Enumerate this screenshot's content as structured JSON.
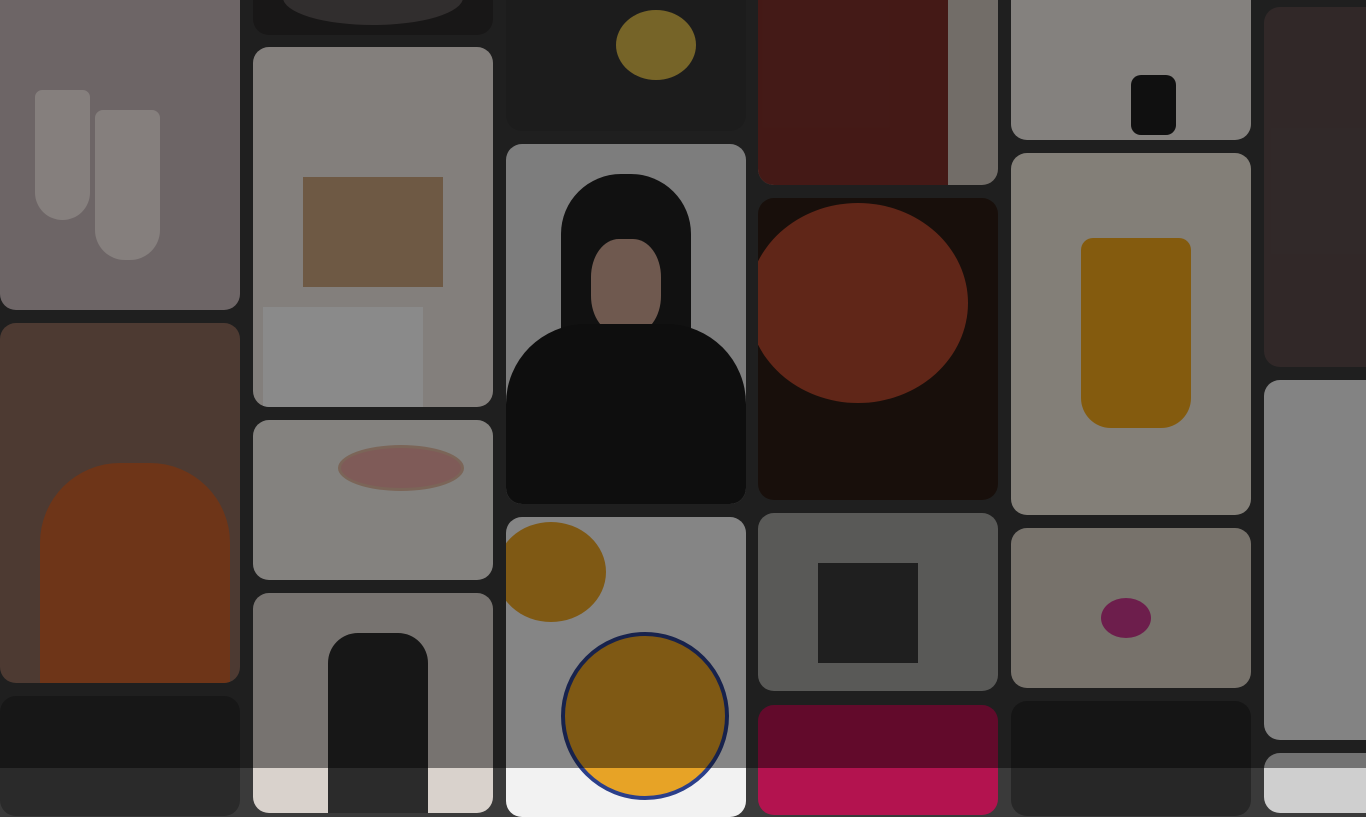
{
  "board": {
    "columns": [
      {
        "pins": [
          {
            "name": "pin-milkshakes",
            "color": "#c7b9bb",
            "accent": "#f2e7e3"
          },
          {
            "name": "pin-mother-daughter",
            "color": "#8c6a5b",
            "accent": "#c9612c"
          },
          {
            "name": "pin-man-hat",
            "color": "#2a2a2a",
            "accent": "#555555"
          }
        ]
      },
      {
        "pins": [
          {
            "name": "pin-dark-dish",
            "color": "#2d2a2a",
            "accent": "#5a5454"
          },
          {
            "name": "pin-nursery-closet",
            "color": "#efe8e2",
            "accent": "#c9a27c"
          },
          {
            "name": "pin-mobile-toy",
            "color": "#f1ede8",
            "accent": "#e7a7a1"
          },
          {
            "name": "pin-black-shirt",
            "color": "#d9d2cc",
            "accent": "#2b2b2b"
          }
        ]
      },
      {
        "pins": [
          {
            "name": "pin-hands-dough",
            "color": "#333333",
            "accent": "#d7b64a"
          },
          {
            "name": "pin-woman-portrait",
            "color": "#e3e3e3",
            "accent": "#1f1f1f"
          },
          {
            "name": "pin-pumpkin-soup",
            "color": "#f2f2f2",
            "accent": "#e7a326"
          }
        ]
      },
      {
        "pins": [
          {
            "name": "pin-patterned-shirt",
            "color": "#cfc7bd",
            "accent": "#7c2f29"
          },
          {
            "name": "pin-spaghetti",
            "color": "#2c1c14",
            "accent": "#b0452c"
          },
          {
            "name": "pin-beach-family",
            "color": "#a2a39f",
            "accent": "#3a3a3a"
          },
          {
            "name": "pin-pink-card",
            "color": "#b3134f",
            "accent": "#b3134f"
          }
        ]
      },
      {
        "pins": [
          {
            "name": "pin-boots",
            "color": "#f0ece6",
            "accent": "#1e1e1e"
          },
          {
            "name": "pin-orange-juice",
            "color": "#eee8da",
            "accent": "#f1a71b"
          },
          {
            "name": "pin-coloring-book",
            "color": "#d9cfc3",
            "accent": "#c7378b"
          },
          {
            "name": "pin-salad-bowl",
            "color": "#272727",
            "accent": "#6e7a4a"
          }
        ]
      },
      {
        "pins": [
          {
            "name": "pin-fashion-coat",
            "color": "#5a4a4a",
            "accent": "#9a7f6f"
          },
          {
            "name": "pin-child-swing",
            "color": "#efefef",
            "accent": "#dcb8b0"
          },
          {
            "name": "pin-edge-bottom",
            "color": "#cfcfcf",
            "accent": "#b0b0b0"
          }
        ]
      }
    ]
  }
}
